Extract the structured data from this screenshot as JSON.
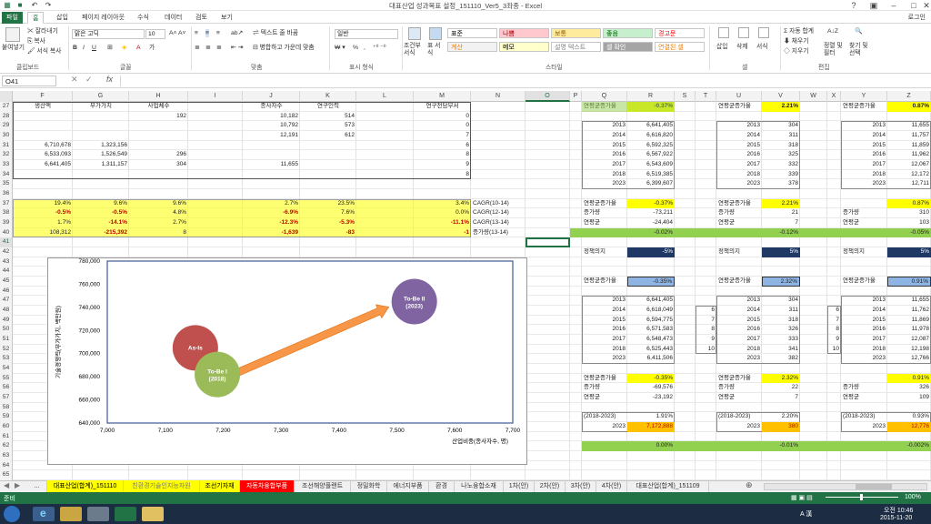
{
  "app": {
    "title": "대표산업 성과목표 설정_151110_Ver5_3좌종 - Excel",
    "login": "로그인"
  },
  "menu": [
    "파일",
    "홈",
    "삽입",
    "페이지 레이아웃",
    "수식",
    "데이터",
    "검토",
    "보기"
  ],
  "ribbon": {
    "paste": "붙여넣기",
    "cut": "잘라내기",
    "copy": "복사",
    "painter": "서식 복사",
    "font_name": "맑은 고딕",
    "font_size": "10",
    "wrap": "텍스트 줄 바꿈",
    "merge": "병합하고 가운데 맞춤",
    "number_format": "일반",
    "percent": "%",
    "comma": ",",
    "cond_fmt": "조건부 서식",
    "table_fmt": "표 서식",
    "styles": [
      {
        "label": "표준",
        "bg": "#ffffff",
        "fg": "#000000"
      },
      {
        "label": "나쁨",
        "bg": "#ffc7ce",
        "fg": "#9c0006"
      },
      {
        "label": "보통",
        "bg": "#ffeb9c",
        "fg": "#9c5700"
      },
      {
        "label": "좋음",
        "bg": "#c6efce",
        "fg": "#006100"
      },
      {
        "label": "경고문",
        "bg": "#ffffff",
        "fg": "#ff0000"
      },
      {
        "label": "계산",
        "bg": "#f2f2f2",
        "fg": "#fa7d00"
      },
      {
        "label": "메모",
        "bg": "#ffffcc",
        "fg": "#000000"
      },
      {
        "label": "설명 텍스트",
        "bg": "#ffffff",
        "fg": "#7f7f7f"
      },
      {
        "label": "셀 확인",
        "bg": "#a5a5a5",
        "fg": "#ffffff"
      },
      {
        "label": "연결된 셀",
        "bg": "#ffffff",
        "fg": "#fa7d00"
      }
    ],
    "insert": "삽입",
    "delete": "삭제",
    "format": "서식",
    "autosum": "자동 합계",
    "fill": "채우기",
    "clear": "지우기",
    "sort": "정렬 및 필터",
    "find": "찾기 및 선택",
    "groups": [
      "클립보드",
      "글꼴",
      "맞춤",
      "표시 형식",
      "스타일",
      "셀",
      "편집"
    ]
  },
  "namebox": "O41",
  "fx": "fx",
  "columns": [
    "F",
    "G",
    "H",
    "I",
    "J",
    "K",
    "L",
    "M",
    "N",
    "O",
    "P",
    "Q",
    "R",
    "S",
    "T",
    "U",
    "V",
    "W",
    "X",
    "Y",
    "Z"
  ],
  "rows": [
    "27",
    "28",
    "29",
    "30",
    "31",
    "32",
    "33",
    "34",
    "35",
    "36",
    "37",
    "38",
    "39",
    "40",
    "41",
    "42",
    "43",
    "44",
    "45",
    "46",
    "47",
    "48",
    "49",
    "50",
    "51",
    "52",
    "53",
    "54",
    "55",
    "56",
    "57",
    "58",
    "59",
    "60",
    "61",
    "62",
    "63",
    "64",
    "65"
  ],
  "table_headers": {
    "f": "생산액",
    "g": "부가가치",
    "h": "사업체수",
    "j": "종사자수",
    "k": "연구인력",
    "m": "연구전담부서"
  },
  "left": {
    "r28": {
      "h": "192",
      "j": "10,182",
      "k": "514",
      "m": "0"
    },
    "r29": {
      "j": "10,792",
      "k": "573",
      "m": "0"
    },
    "r30": {
      "j": "12,191",
      "k": "612",
      "m": "7"
    },
    "r31": {
      "f": "6,710,678",
      "g": "1,323,156",
      "m": "6"
    },
    "r32": {
      "f": "6,533,093",
      "g": "1,526,549",
      "h": "296",
      "m": "8"
    },
    "r33": {
      "f": "6,641,405",
      "g": "1,311,157",
      "h": "304",
      "j": "11,655",
      "m": "9"
    },
    "r34": {
      "m": "8"
    },
    "r37": {
      "f": "19.4%",
      "g": "9.6%",
      "h": "9.6%",
      "j": "2.7%",
      "k": "23.5%",
      "m": "3.4%",
      "n": "CAGR(10-14)"
    },
    "r38": {
      "f": "-0.5%",
      "g": "-0.5%",
      "h": "4.8%",
      "j": "-6.9%",
      "k": "7.6%",
      "m": "0.0%",
      "n": "CAGR(12-14)"
    },
    "r39": {
      "f": "1.7%",
      "g": "-14.1%",
      "h": "2.7%",
      "j": "-12.3%",
      "k": "-5.3%",
      "m": "-11.1%",
      "n": "CAGR(13-14)"
    },
    "r40": {
      "f": "108,312",
      "g": "-215,392",
      "h": "8",
      "j": "-1,639",
      "k": "-83",
      "m": "-1",
      "n": "증가량(13-14)"
    }
  },
  "right": {
    "q27": "연평균증가율",
    "r27": "-0.37%",
    "u27": "연평균증가율",
    "v27": "2.21%",
    "y27": "연평균증가율",
    "z27": "0.87%",
    "block1": {
      "years": [
        "2013",
        "2014",
        "2015",
        "2016",
        "2017",
        "2018",
        "2023"
      ],
      "r": [
        "6,641,405",
        "6,616,820",
        "6,592,325",
        "6,567,922",
        "6,543,609",
        "6,519,385",
        "6,399,607"
      ],
      "v": [
        "304",
        "311",
        "318",
        "325",
        "332",
        "339",
        "378"
      ],
      "z": [
        "11,655",
        "11,757",
        "11,859",
        "11,962",
        "12,067",
        "12,172",
        "12,711"
      ]
    },
    "q37": "연평균증가율",
    "r37": "-0.37%",
    "u37": "연평균증가율",
    "v37": "2.21%",
    "z37": "0.87%",
    "q38": "증가량",
    "r38": "-73,211",
    "u38": "증가량",
    "v38": "21",
    "y38": "증가량",
    "z38": "310",
    "q39": "연평균",
    "r39": "-24,404",
    "u39": "연평균",
    "v39": "7",
    "y39": "연평균",
    "z39": "103",
    "r40": "-0.02%",
    "v40": "-0.12%",
    "z40": "-0.05%",
    "q42": "정책의지",
    "r42": "-5%",
    "u42": "정책의지",
    "v42": "5%",
    "y42": "정책의지",
    "z42": "5%",
    "q45": "연평균증가율",
    "r45": "-0.35%",
    "u45": "연평균증가율",
    "v45": "2.32%",
    "y45": "연평균증가율",
    "z45": "0.91%",
    "block2": {
      "years": [
        "2013",
        "2014",
        "2015",
        "2016",
        "2017",
        "2018",
        "2023"
      ],
      "r": [
        "6,641,405",
        "6,618,049",
        "6,594,775",
        "6,571,583",
        "6,548,473",
        "6,525,443",
        "6,411,506"
      ],
      "t": [
        "6",
        "7",
        "8",
        "9",
        "10"
      ],
      "v": [
        "304",
        "311",
        "318",
        "326",
        "333",
        "341",
        "382"
      ],
      "x": [
        "6",
        "7",
        "8",
        "9",
        "10"
      ],
      "z": [
        "11,655",
        "11,762",
        "11,869",
        "11,978",
        "12,087",
        "12,198",
        "12,766"
      ]
    },
    "q55": "연평균증가율",
    "r55": "-0.35%",
    "u55": "연평균증가율",
    "v55": "2.32%",
    "z55": "0.91%",
    "q56": "증가량",
    "r56": "-69,576",
    "u56": "증가량",
    "v56": "22",
    "y56": "증가량",
    "z56": "326",
    "q57": "연평균",
    "r57": "-23,192",
    "u57": "연평균",
    "v57": "7",
    "y57": "연평균",
    "z57": "109",
    "q59": "(2018-2023)",
    "r59": "1.91%",
    "u59": "(2018-2023)",
    "v59": "2.20%",
    "y59": "(2018-2023)",
    "z59": "0.93%",
    "q60": "2023",
    "r60": "7,172,888",
    "u60": "2023",
    "v60": "380",
    "y60": "2023",
    "z60": "12,776",
    "r62": "0.00%",
    "v62": "-0.01%",
    "z62": "-0.002%"
  },
  "chart_data": {
    "type": "scatter",
    "ylabel": "기술경쟁력(부가가치, 백만원)",
    "xlabel": "산업비중(종사자수, 명)",
    "xlim": [
      7000,
      7700
    ],
    "ylim": [
      640000,
      780000
    ],
    "xticks": [
      "7,000",
      "7,100",
      "7,200",
      "7,300",
      "7,400",
      "7,500",
      "7,600",
      "7,700"
    ],
    "yticks": [
      "780,000",
      "760,000",
      "740,000",
      "720,000",
      "700,000",
      "680,000",
      "660,000",
      "640,000"
    ],
    "points": [
      {
        "label": "As-Is",
        "x": 7152,
        "y": 705000,
        "color": "#c0504d"
      },
      {
        "label": "To-Be I (2018)",
        "x": 7190,
        "y": 682000,
        "color": "#9bbb59"
      },
      {
        "label": "To-Be II (2023)",
        "x": 7530,
        "y": 745000,
        "color": "#8064a2"
      }
    ],
    "arrow_color": "#f79646"
  },
  "sheet_tabs": [
    {
      "label": "...",
      "bg": "",
      "fg": "#333"
    },
    {
      "label": "대표산업(합계)_151110",
      "bg": "#ffff00",
      "fg": "#000"
    },
    {
      "label": "친환경기술인지능자원",
      "bg": "#ffff00",
      "fg": "#777"
    },
    {
      "label": "조선기자재",
      "bg": "#ffff00",
      "fg": "#000"
    },
    {
      "label": "자동차융합부품",
      "bg": "#ff0000",
      "fg": "#fff"
    },
    {
      "label": "조선해양플랜트",
      "bg": "",
      "fg": "#333"
    },
    {
      "label": "정밀화학",
      "bg": "",
      "fg": "#333"
    },
    {
      "label": "에너지부품",
      "bg": "",
      "fg": "#333"
    },
    {
      "label": "환경",
      "bg": "",
      "fg": "#333"
    },
    {
      "label": "나노융합소재",
      "bg": "",
      "fg": "#333"
    },
    {
      "label": "1차(안)",
      "bg": "",
      "fg": "#333"
    },
    {
      "label": "2차(안)",
      "bg": "",
      "fg": "#333"
    },
    {
      "label": "3차(안)",
      "bg": "",
      "fg": "#333"
    },
    {
      "label": "4차(안)",
      "bg": "",
      "fg": "#333"
    },
    {
      "label": "대표산업(합계)_151109",
      "bg": "",
      "fg": "#333"
    }
  ],
  "status": {
    "ready": "준비",
    "zoom": "100%"
  },
  "taskbar": {
    "time": "오전 10:46",
    "date": "2015-11-20",
    "ime": "A 漢"
  }
}
